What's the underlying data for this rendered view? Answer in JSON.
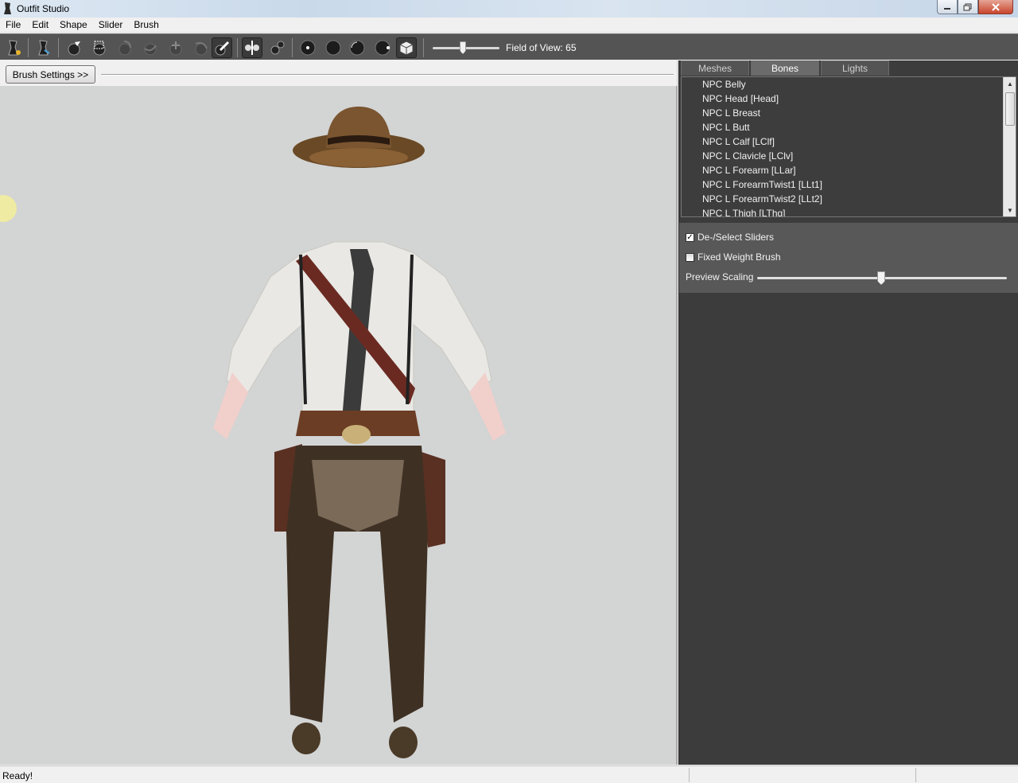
{
  "window": {
    "title": "Outfit Studio"
  },
  "menu": [
    "File",
    "Edit",
    "Shape",
    "Slider",
    "Brush"
  ],
  "toolbar": {
    "fov_label": "Field of View: 65",
    "fov_value": 65,
    "tools": [
      "select-tool",
      "transform-tool",
      "mask-brush",
      "select-area",
      "inflate-brush",
      "deflate-brush",
      "move-brush",
      "smooth-brush",
      "weight-brush",
      "x-mirror",
      "connected-only",
      "brush-size-1",
      "brush-size-2",
      "brush-size-3",
      "brush-size-4",
      "perspective-view"
    ]
  },
  "brush_settings": {
    "label": "Brush Settings >>"
  },
  "panel": {
    "tabs": [
      "Meshes",
      "Bones",
      "Lights"
    ],
    "active_tab": "Bones",
    "bones": [
      "NPC Belly",
      "NPC Head [Head]",
      "NPC L Breast",
      "NPC L Butt",
      "NPC L Calf [LClf]",
      "NPC L Clavicle [LClv]",
      "NPC L Forearm [LLar]",
      "NPC L ForearmTwist1 [LLt1]",
      "NPC L ForearmTwist2 [LLt2]",
      "NPC L Thigh [LThg]"
    ],
    "options": {
      "deselect_sliders": {
        "label": "De-/Select Sliders",
        "checked": true
      },
      "fixed_weight": {
        "label": "Fixed Weight Brush",
        "checked": false
      },
      "preview_scaling": {
        "label": "Preview Scaling",
        "value": 0.5
      }
    }
  },
  "status": {
    "text": "Ready!"
  }
}
